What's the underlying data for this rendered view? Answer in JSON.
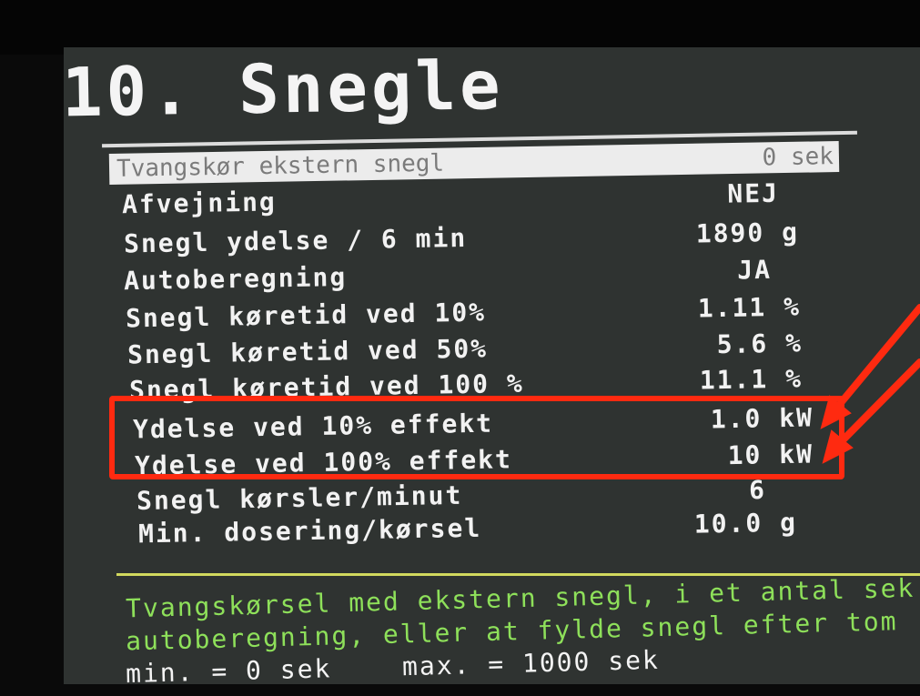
{
  "page": {
    "title": "10. Snegle",
    "selected": {
      "label": "Tvangskør ekstern snegl",
      "value": "0 sek"
    },
    "rows": [
      {
        "label": "Afvejning",
        "value": "NEJ"
      },
      {
        "label": "Snegl ydelse / 6 min",
        "value": "1890 g"
      },
      {
        "label": "Autoberegning",
        "value": "JA"
      },
      {
        "label": "Snegl køretid ved 10%",
        "value": "1.11 %"
      },
      {
        "label": "Snegl køretid ved 50%",
        "value": "5.6 %"
      },
      {
        "label": "Snegl køretid ved 100 %",
        "value": "11.1 %"
      },
      {
        "label": "Ydelse ved 10% effekt",
        "value": "1.0 kW"
      },
      {
        "label": "Ydelse ved 100% effekt",
        "value": "10 kW"
      },
      {
        "label": "Snegl kørsler/minut",
        "value": "6"
      },
      {
        "label": "Min. dosering/kørsel",
        "value": "10.0 g"
      }
    ],
    "help": {
      "line1": "Tvangskørsel med ekstern snegl, i et antal sek",
      "line2": "autoberegning, eller at fylde snegl efter tom",
      "min": "min. = 0 sek",
      "max": "max. = 1000 sek"
    }
  },
  "annotation": {
    "color": "#ff2a10"
  }
}
